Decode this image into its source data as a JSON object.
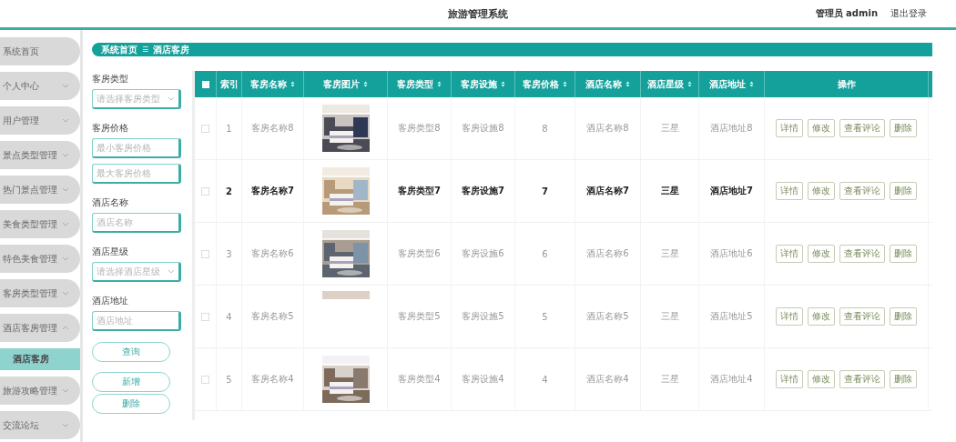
{
  "header": {
    "title": "旅游管理系统",
    "user": "管理员 admin",
    "logout": "退出登录"
  },
  "sidebar": {
    "items": [
      {
        "label": "系统首页",
        "expandable": false,
        "expanded": false
      },
      {
        "label": "个人中心",
        "expandable": true,
        "expanded": false
      },
      {
        "label": "用户管理",
        "expandable": true,
        "expanded": false
      },
      {
        "label": "景点类型管理",
        "expandable": true,
        "expanded": false
      },
      {
        "label": "热门景点管理",
        "expandable": true,
        "expanded": false
      },
      {
        "label": "美食类型管理",
        "expandable": true,
        "expanded": false
      },
      {
        "label": "特色美食管理",
        "expandable": true,
        "expanded": false
      },
      {
        "label": "客房类型管理",
        "expandable": true,
        "expanded": false
      },
      {
        "label": "酒店客房管理",
        "expandable": true,
        "expanded": true,
        "children": [
          {
            "label": "酒店客房",
            "selected": true
          }
        ]
      },
      {
        "label": "旅游攻略管理",
        "expandable": true,
        "expanded": false
      },
      {
        "label": "交流论坛",
        "expandable": true,
        "expanded": false
      }
    ]
  },
  "breadcrumb": {
    "items": [
      "系统首页",
      "酒店客房"
    ],
    "separator": "☰"
  },
  "filters": [
    {
      "label": "客房类型",
      "fields": [
        {
          "kind": "select",
          "placeholder": "请选择客房类型"
        }
      ]
    },
    {
      "label": "客房价格",
      "fields": [
        {
          "kind": "input",
          "placeholder": "最小客房价格"
        },
        {
          "kind": "input",
          "placeholder": "最大客房价格"
        }
      ]
    },
    {
      "label": "酒店名称",
      "fields": [
        {
          "kind": "input",
          "placeholder": "酒店名称"
        }
      ]
    },
    {
      "label": "酒店星级",
      "fields": [
        {
          "kind": "select",
          "placeholder": "请选择酒店星级"
        }
      ]
    },
    {
      "label": "酒店地址",
      "fields": [
        {
          "kind": "input",
          "placeholder": "酒店地址"
        }
      ]
    }
  ],
  "filter_buttons": [
    "查询",
    "新增",
    "删除"
  ],
  "table": {
    "select_all_checked": false,
    "columns": [
      {
        "label": "索引",
        "sortable": false
      },
      {
        "label": "客房名称",
        "sortable": true
      },
      {
        "label": "客房图片",
        "sortable": true
      },
      {
        "label": "客房类型",
        "sortable": true
      },
      {
        "label": "客房设施",
        "sortable": true
      },
      {
        "label": "客房价格",
        "sortable": true
      },
      {
        "label": "酒店名称",
        "sortable": true
      },
      {
        "label": "酒店星级",
        "sortable": true
      },
      {
        "label": "酒店地址",
        "sortable": true
      },
      {
        "label": "操作",
        "sortable": false
      }
    ],
    "rows": [
      {
        "index": "1",
        "name": "客房名称8",
        "image": {
          "kind": "picture",
          "partial": false
        },
        "type": "客房类型8",
        "facility": "客房设施8",
        "price": "8",
        "hotel": "酒店名称8",
        "stars": "三星",
        "address": "酒店地址8",
        "checked": false,
        "highlighted": false,
        "actions": [
          "详情",
          "修改",
          "查看评论",
          "删除"
        ]
      },
      {
        "index": "2",
        "name": "客房名称7",
        "image": {
          "kind": "picture",
          "partial": false
        },
        "type": "客房类型7",
        "facility": "客房设施7",
        "price": "7",
        "hotel": "酒店名称7",
        "stars": "三星",
        "address": "酒店地址7",
        "checked": false,
        "highlighted": true,
        "actions": [
          "详情",
          "修改",
          "查看评论",
          "删除"
        ]
      },
      {
        "index": "3",
        "name": "客房名称6",
        "image": {
          "kind": "picture",
          "partial": false
        },
        "type": "客房类型6",
        "facility": "客房设施6",
        "price": "6",
        "hotel": "酒店名称6",
        "stars": "三星",
        "address": "酒店地址6",
        "checked": false,
        "highlighted": false,
        "actions": [
          "详情",
          "修改",
          "查看评论",
          "删除"
        ]
      },
      {
        "index": "4",
        "name": "客房名称5",
        "image": {
          "kind": "picture",
          "partial": true
        },
        "type": "客房类型5",
        "facility": "客房设施5",
        "price": "5",
        "hotel": "酒店名称5",
        "stars": "三星",
        "address": "酒店地址5",
        "checked": false,
        "highlighted": false,
        "actions": [
          "详情",
          "修改",
          "查看评论",
          "删除"
        ]
      },
      {
        "index": "5",
        "name": "客房名称4",
        "image": {
          "kind": "picture",
          "partial": false
        },
        "type": "客房类型4",
        "facility": "客房设施4",
        "price": "4",
        "hotel": "酒店名称4",
        "stars": "三星",
        "address": "酒店地址4",
        "checked": false,
        "highlighted": false,
        "actions": [
          "详情",
          "修改",
          "查看评论",
          "删除"
        ]
      }
    ]
  }
}
